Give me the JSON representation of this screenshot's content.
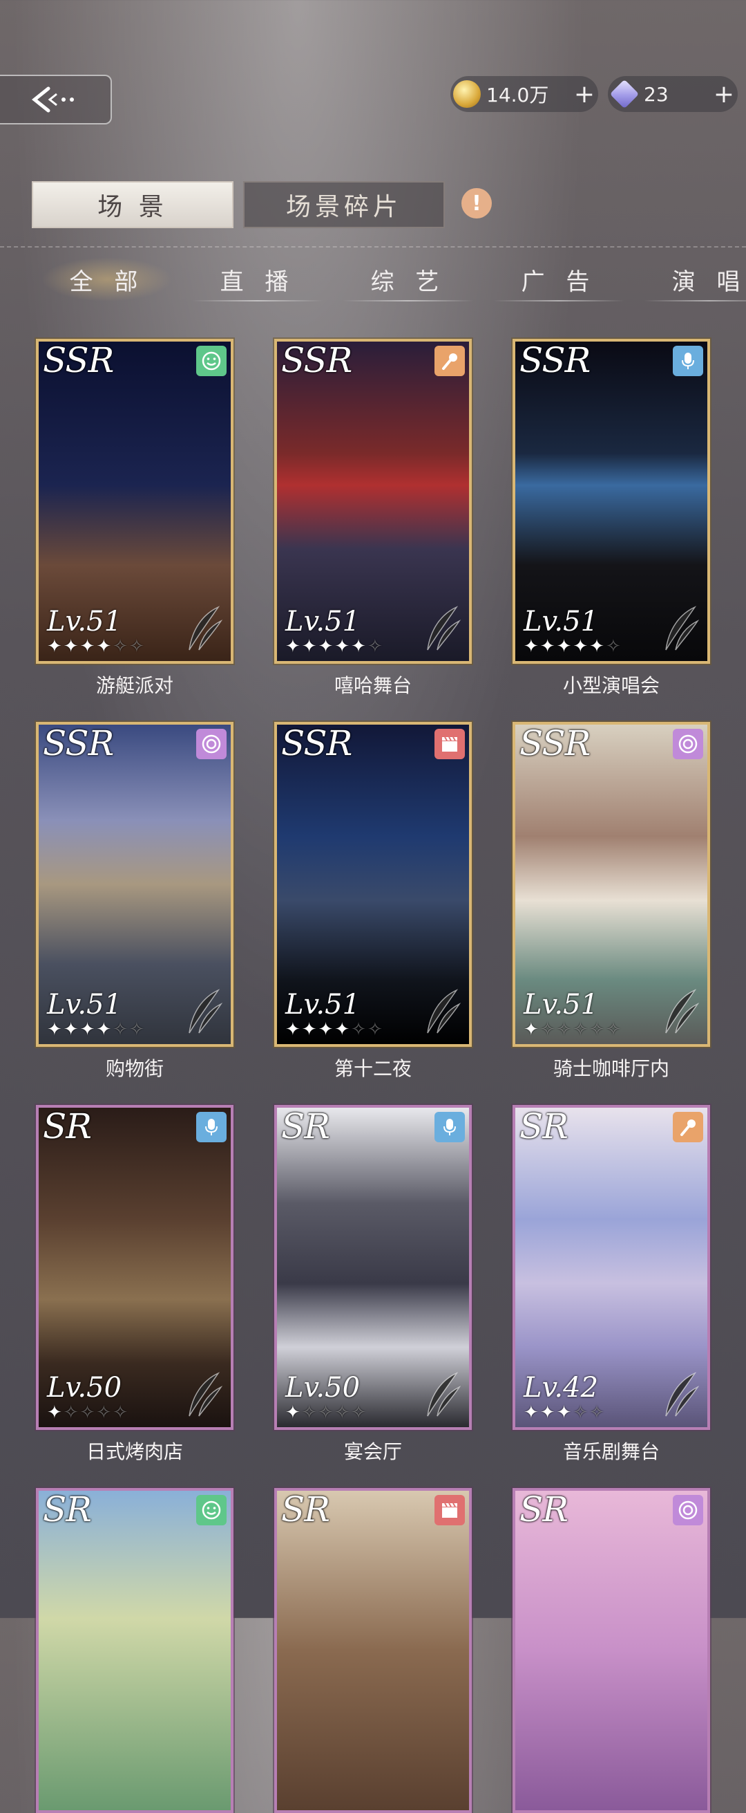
{
  "topbar": {
    "coins": "14.0万",
    "gems": "23",
    "plus": "+"
  },
  "main_tabs": {
    "scene": "场 景",
    "fragments": "场景碎片",
    "alert": "!"
  },
  "sub_tabs": [
    "全 部",
    "直 播",
    "综 艺",
    "广 告",
    "演 唱"
  ],
  "cards": [
    {
      "rarity": "SSR",
      "name": "游艇派对",
      "level": "Lv.51",
      "stars_on": 4,
      "stars_total": 6,
      "icon": "smile-icon",
      "icon_color": "#5fc78a"
    },
    {
      "rarity": "SSR",
      "name": "嘻哈舞台",
      "level": "Lv.51",
      "stars_on": 5,
      "stars_total": 6,
      "icon": "microphone-icon",
      "icon_color": "#e9a36a"
    },
    {
      "rarity": "SSR",
      "name": "小型演唱会",
      "level": "Lv.51",
      "stars_on": 5,
      "stars_total": 6,
      "icon": "studio-mic-icon",
      "icon_color": "#6aaede"
    },
    {
      "rarity": "SSR",
      "name": "购物街",
      "level": "Lv.51",
      "stars_on": 4,
      "stars_total": 6,
      "icon": "camera-lens-icon",
      "icon_color": "#c08ad9"
    },
    {
      "rarity": "SSR",
      "name": "第十二夜",
      "level": "Lv.51",
      "stars_on": 4,
      "stars_total": 6,
      "icon": "clapperboard-icon",
      "icon_color": "#e07070"
    },
    {
      "rarity": "SSR",
      "name": "骑士咖啡厅内",
      "level": "Lv.51",
      "stars_on": 1,
      "stars_total": 6,
      "icon": "camera-lens-icon",
      "icon_color": "#c08ad9"
    },
    {
      "rarity": "SR",
      "name": "日式烤肉店",
      "level": "Lv.50",
      "stars_on": 1,
      "stars_total": 5,
      "icon": "studio-mic-icon",
      "icon_color": "#6aaede"
    },
    {
      "rarity": "SR",
      "name": "宴会厅",
      "level": "Lv.50",
      "stars_on": 1,
      "stars_total": 5,
      "icon": "studio-mic-icon",
      "icon_color": "#6aaede"
    },
    {
      "rarity": "SR",
      "name": "音乐剧舞台",
      "level": "Lv.42",
      "stars_on": 3,
      "stars_total": 5,
      "icon": "microphone-icon",
      "icon_color": "#e9a36a"
    },
    {
      "rarity": "SR",
      "name": "",
      "level": "",
      "stars_on": 0,
      "stars_total": 0,
      "icon": "smile-icon",
      "icon_color": "#5fc78a"
    },
    {
      "rarity": "SR",
      "name": "",
      "level": "",
      "stars_on": 0,
      "stars_total": 0,
      "icon": "clapperboard-icon",
      "icon_color": "#e07070"
    },
    {
      "rarity": "SR",
      "name": "",
      "level": "",
      "stars_on": 0,
      "stars_total": 0,
      "icon": "camera-lens-icon",
      "icon_color": "#c08ad9"
    }
  ]
}
